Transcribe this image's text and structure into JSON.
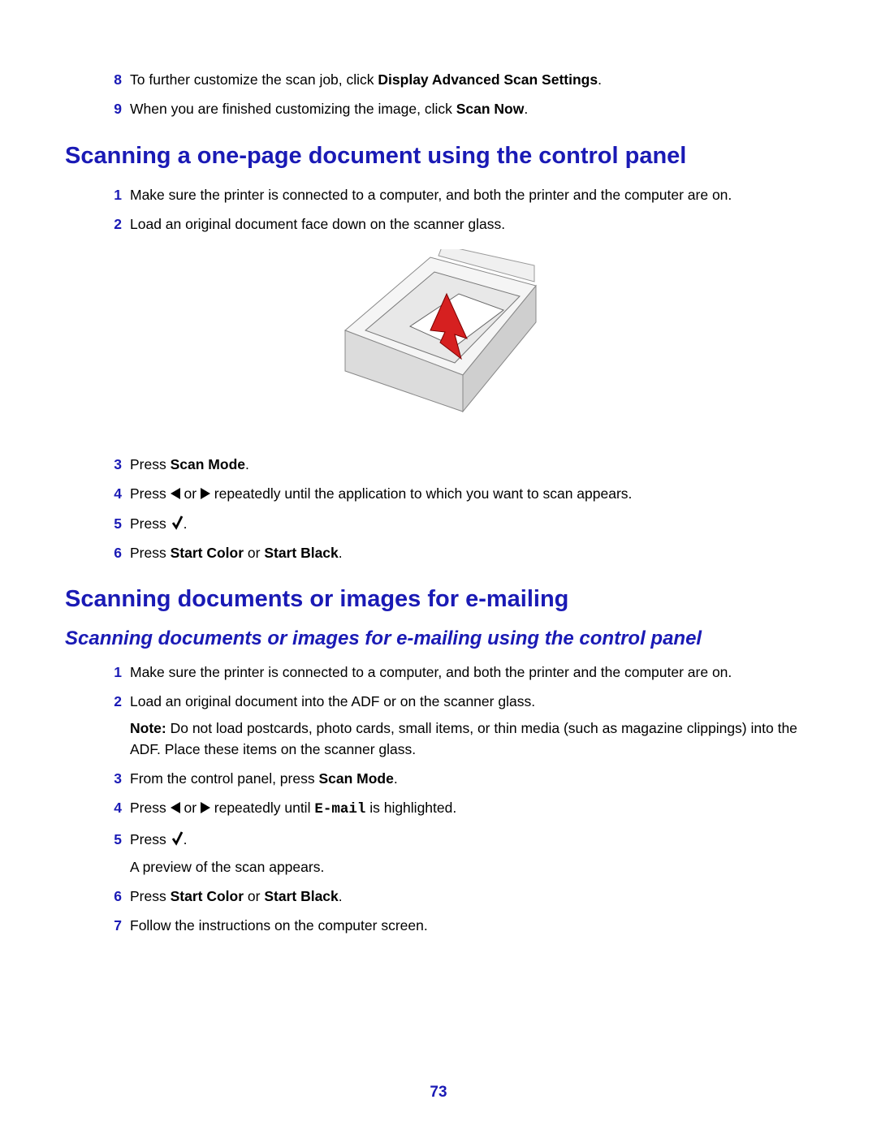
{
  "continuation": {
    "step8": {
      "num": "8",
      "prefix": "To further customize the scan job, click ",
      "bold": "Display Advanced Scan Settings",
      "suffix": "."
    },
    "step9": {
      "num": "9",
      "prefix": "When you are finished customizing the image, click ",
      "bold": "Scan Now",
      "suffix": "."
    }
  },
  "section1": {
    "heading": "Scanning a one-page document using the control panel",
    "steps": {
      "s1": {
        "num": "1",
        "text": "Make sure the printer is connected to a computer, and both the printer and the computer are on."
      },
      "s2": {
        "num": "2",
        "text": "Load an original document face down on the scanner glass."
      },
      "s3": {
        "num": "3",
        "prefix": "Press ",
        "bold": "Scan Mode",
        "suffix": "."
      },
      "s4": {
        "num": "4",
        "prefix": "Press ",
        "mid": " or ",
        "suffix": " repeatedly until the application to which you want to scan appears."
      },
      "s5": {
        "num": "5",
        "prefix": "Press ",
        "suffix": "."
      },
      "s6": {
        "num": "6",
        "prefix": "Press ",
        "bold1": "Start Color",
        "mid": " or ",
        "bold2": "Start Black",
        "suffix": "."
      }
    }
  },
  "section2": {
    "heading": "Scanning documents or images for e-mailing",
    "subheading": "Scanning documents or images for e-mailing using the control panel",
    "steps": {
      "s1": {
        "num": "1",
        "text": "Make sure the printer is connected to a computer, and both the printer and the computer are on."
      },
      "s2": {
        "num": "2",
        "text": "Load an original document into the ADF or on the scanner glass.",
        "note_label": "Note:",
        "note_text": " Do not load postcards, photo cards, small items, or thin media (such as magazine clippings) into the ADF. Place these items on the scanner glass."
      },
      "s3": {
        "num": "3",
        "prefix": "From the control panel, press ",
        "bold": "Scan Mode",
        "suffix": "."
      },
      "s4": {
        "num": "4",
        "prefix": "Press ",
        "mid": " or ",
        "suffix_a": " repeatedly until ",
        "mono": "E-mail",
        "suffix_b": " is highlighted."
      },
      "s5": {
        "num": "5",
        "prefix": "Press ",
        "suffix": ".",
        "follow": "A preview of the scan appears."
      },
      "s6": {
        "num": "6",
        "prefix": "Press ",
        "bold1": "Start Color",
        "mid": " or ",
        "bold2": "Start Black",
        "suffix": "."
      },
      "s7": {
        "num": "7",
        "text": "Follow the instructions on the computer screen."
      }
    }
  },
  "page_number": "73",
  "icons": {
    "left_arrow": "left-arrow-icon",
    "right_arrow": "right-arrow-icon",
    "check": "checkmark-icon"
  }
}
